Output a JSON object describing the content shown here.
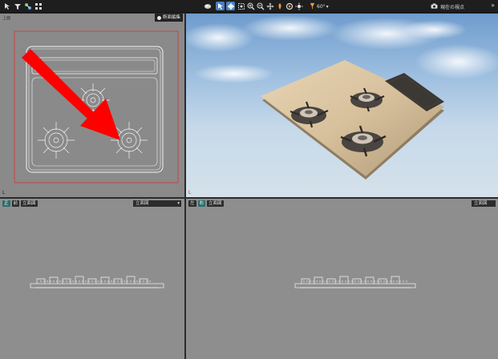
{
  "toolbar": {
    "icons": [
      "pointer-icon",
      "filter-icon",
      "link-icon",
      "grid-icon",
      "render-style-icon",
      "select-arrow-icon",
      "snap-icon",
      "zoom-region-icon",
      "zoom-in-icon",
      "zoom-out-icon",
      "pan-icon",
      "light-icon",
      "orbit-icon",
      "sun-icon",
      "lamp-icon"
    ],
    "view_angle": "60°",
    "camera_label": "現在の視点",
    "more": "»"
  },
  "viewports": {
    "top": {
      "small_label": "上面",
      "section_edit": "断面編集",
      "axis": "L"
    },
    "perspective": {
      "axis": "L"
    },
    "front": {
      "tag_direction": "正",
      "tag_view": "前",
      "tag_name": "立面図",
      "select_value": "立面図"
    },
    "side": {
      "tag_direction": "左",
      "tag_view": "右",
      "tag_name": "立面図",
      "select_value": "立面図"
    }
  },
  "colors": {
    "annotation_arrow": "#ff0000",
    "frame_red": "#e03030",
    "highlight_blue": "#4a7fc0"
  }
}
